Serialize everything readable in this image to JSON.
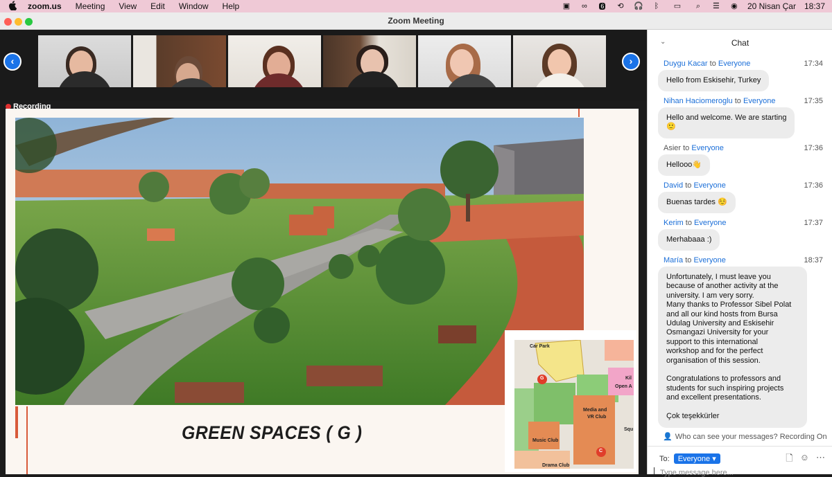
{
  "menubar": {
    "app_name": "zoom.us",
    "items": [
      "Meeting",
      "View",
      "Edit",
      "Window",
      "Help"
    ],
    "date": "20 Nisan Çar",
    "time": "18:37",
    "notif_count": "6"
  },
  "window": {
    "title": "Zoom Meeting"
  },
  "recording": {
    "label": "Recording"
  },
  "slide": {
    "title": "GREEN SPACES  ( G )"
  },
  "map": {
    "labels": [
      "Car Park",
      "Media and",
      "VR Club",
      "Music Club",
      "Kil",
      "Open A",
      "Squ",
      "Drama Club"
    ],
    "markers": [
      "G",
      "C"
    ]
  },
  "chat": {
    "title": "Chat",
    "messages": [
      {
        "sender": "Duygu Kacar",
        "to": "to",
        "recipient": "Everyone",
        "time": "17:34",
        "text": "Hello from Eskisehir, Turkey"
      },
      {
        "sender": "Nihan Haciomeroglu",
        "to": "to",
        "recipient": "Everyone",
        "time": "17:35",
        "text": "Hello and welcome. We are starting\n🙂"
      },
      {
        "sender": "Asier",
        "to": "to",
        "recipient": "Everyone",
        "time": "17:36",
        "text": "Hellooo👋"
      },
      {
        "sender": "David",
        "to": "to",
        "recipient": "Everyone",
        "time": "17:36",
        "text": "Buenas tardes ☺️"
      },
      {
        "sender": "Kerim",
        "to": "to",
        "recipient": "Everyone",
        "time": "17:37",
        "text": "Merhabaaa :)"
      },
      {
        "sender": "María",
        "to": "to",
        "recipient": "Everyone",
        "time": "18:37",
        "text": "Unfortunately, I must leave you\nbecause of another activity at the\nuniversity. I am very sorry.\nMany thanks to Professor Sibel Polat\nand all our kind hosts from Bursa\nUdulag University and Eskisehir\nOsmangazi University for your\nsupport to this international\nworkshop and for the perfect\norganisation of this session.\n\nCongratulations to professors and\nstudents for such inspiring projects\nand excellent presentations.\n\nÇok teşekkürler"
      }
    ],
    "privacy_text": "Who can see your messages? Recording On",
    "to_label": "To:",
    "to_value": "Everyone",
    "input_placeholder": "Type message here..."
  }
}
